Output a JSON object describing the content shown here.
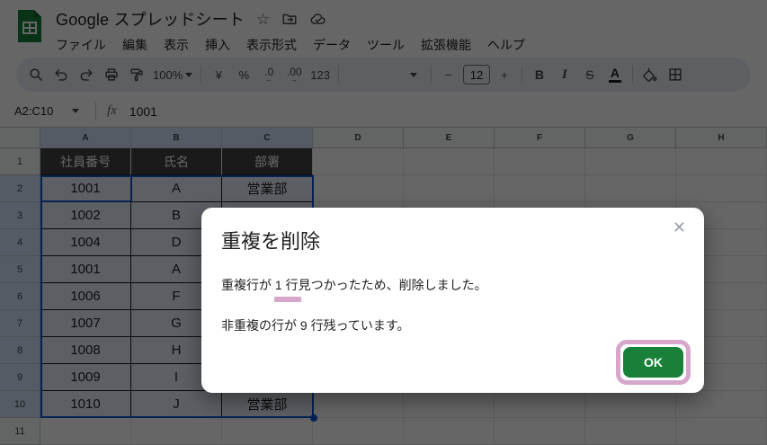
{
  "app": {
    "title": "Google スプレッドシート",
    "menu_items": [
      "ファイル",
      "編集",
      "表示",
      "挿入",
      "表示形式",
      "データ",
      "ツール",
      "拡張機能",
      "ヘルプ"
    ]
  },
  "toolbar": {
    "zoom_value": "100%",
    "currency_label": "¥",
    "percent_label": "%",
    "decrease_decimal_label": ".0",
    "decrease_decimal_arrow": "←",
    "increase_decimal_label": ".00",
    "increase_decimal_arrow": "→",
    "more_formats_label": "123",
    "decrease_font_label": "−",
    "font_size_value": "12",
    "increase_font_label": "+",
    "bold_label": "B",
    "italic_label": "I",
    "strikethrough_label": "S",
    "text_color_label": "A"
  },
  "formula_bar": {
    "name_box_value": "A2:C10",
    "fx_label": "fx",
    "cell_value": "1001"
  },
  "grid": {
    "column_headers": [
      "A",
      "B",
      "C",
      "D",
      "E",
      "F",
      "G",
      "H"
    ],
    "selected_columns": [
      "A",
      "B",
      "C"
    ],
    "row_numbers": [
      "1",
      "2",
      "3",
      "4",
      "5",
      "6",
      "7",
      "8",
      "9",
      "10",
      "11"
    ],
    "selected_rows": [
      "2",
      "3",
      "4",
      "5",
      "6",
      "7",
      "8",
      "9",
      "10"
    ],
    "selection": {
      "range": "A2:C10",
      "active_cell": "A2"
    },
    "table": {
      "headers": [
        "社員番号",
        "氏名",
        "部署"
      ],
      "rows": [
        [
          "1001",
          "A",
          "営業部"
        ],
        [
          "1002",
          "B",
          ""
        ],
        [
          "1004",
          "D",
          ""
        ],
        [
          "1001",
          "A",
          ""
        ],
        [
          "1006",
          "F",
          ""
        ],
        [
          "1007",
          "G",
          ""
        ],
        [
          "1008",
          "H",
          ""
        ],
        [
          "1009",
          "I",
          ""
        ],
        [
          "1010",
          "J",
          "営業部"
        ]
      ]
    }
  },
  "dialog": {
    "title": "重複を削除",
    "message_line1_prefix": "重複行が ",
    "message_line1_highlight": "1 行",
    "message_line1_suffix": "見つかったため、削除しました。",
    "message_line2": "非重複の行が 9 行残っています。",
    "ok_label": "OK",
    "close_label": "✕"
  },
  "colors": {
    "accent_blue": "#0b57d0",
    "ok_green": "#188038",
    "annotation_pink": "#d6a7cb",
    "table_header_bg": "#434343",
    "selected_header_bg": "#d3e3fd"
  }
}
